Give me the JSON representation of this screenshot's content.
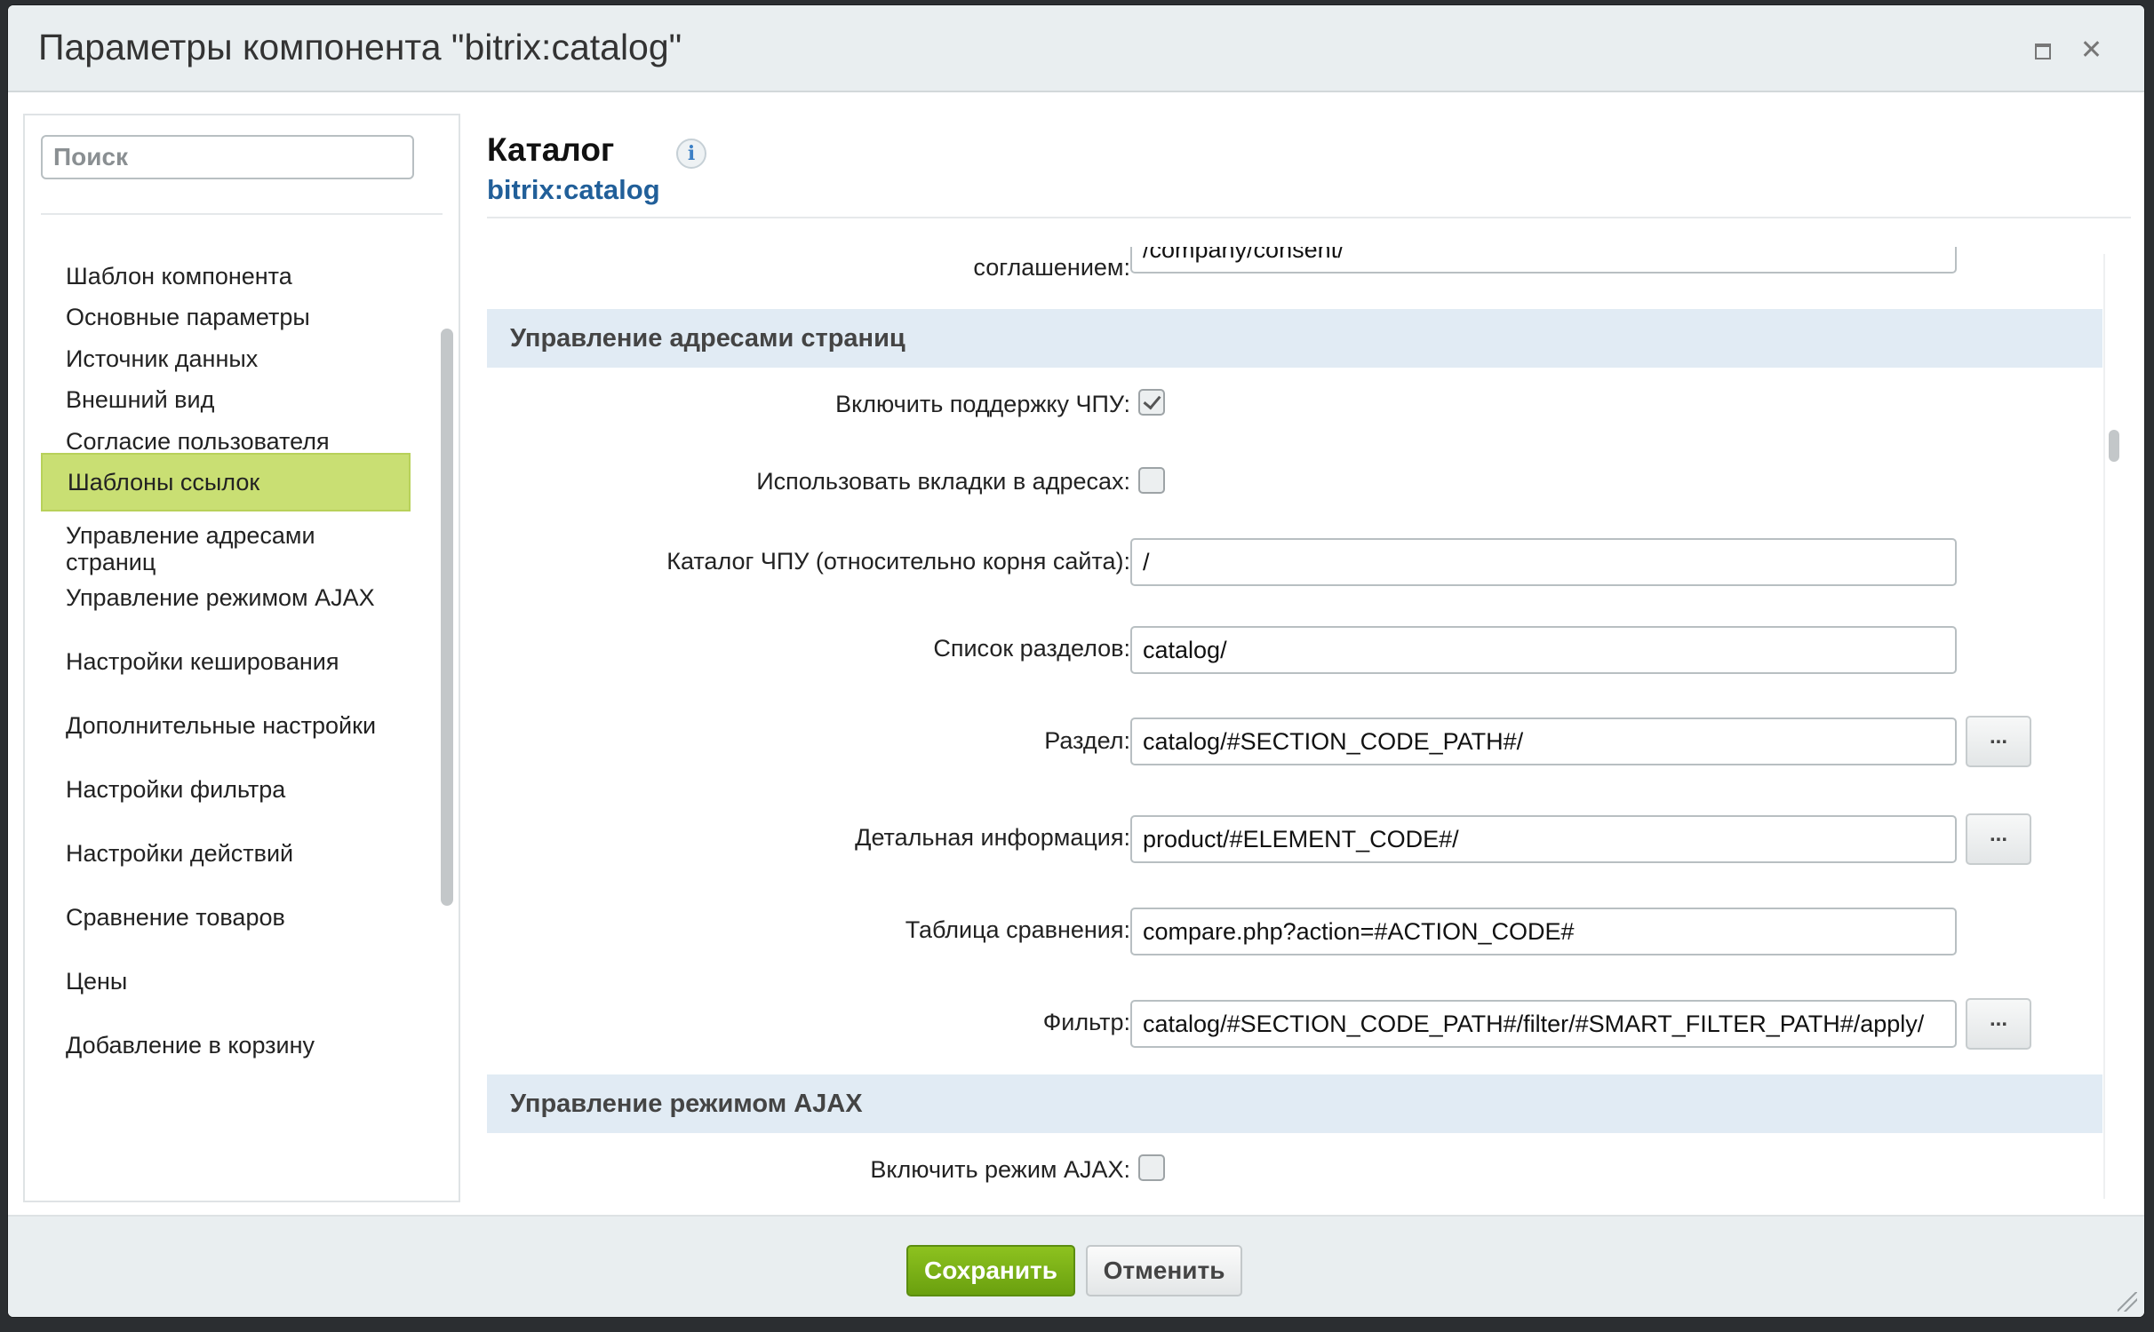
{
  "dialog": {
    "title": "Параметры компонента \"bitrix:catalog\""
  },
  "sidebar": {
    "search_placeholder": "Поиск",
    "items": [
      {
        "label": "Шаблон компонента"
      },
      {
        "label": "Основные параметры"
      },
      {
        "label": "Источник данных"
      },
      {
        "label": "Внешний вид"
      },
      {
        "label": "Согласие пользователя"
      },
      {
        "label": "Шаблоны ссылок",
        "active": true
      },
      {
        "label": "Управление адресами страниц"
      },
      {
        "label": "Управление режимом AJAX"
      },
      {
        "label": "Настройки кеширования"
      },
      {
        "label": "Дополнительные настройки"
      },
      {
        "label": "Настройки фильтра"
      },
      {
        "label": "Настройки действий"
      },
      {
        "label": "Сравнение товаров"
      },
      {
        "label": "Цены"
      },
      {
        "label": "Добавление в корзину"
      }
    ]
  },
  "component": {
    "title": "Каталог",
    "code": "bitrix:catalog"
  },
  "main": {
    "partial_row": {
      "label": "соглашением:",
      "value": "/company/consent/"
    },
    "section_urls": {
      "title": "Управление адресами страниц",
      "sef_enable": {
        "label": "Включить поддержку ЧПУ:",
        "checked": true
      },
      "sef_tabs": {
        "label": "Использовать вкладки в адресах:",
        "checked": false
      },
      "sef_folder": {
        "label": "Каталог ЧПУ (относительно корня сайта):",
        "value": "/"
      },
      "sections_list": {
        "label": "Список разделов:",
        "value": "catalog/"
      },
      "section": {
        "label": "Раздел:",
        "value": "catalog/#SECTION_CODE_PATH#/",
        "button": "..."
      },
      "detail": {
        "label": "Детальная информация:",
        "value": "product/#ELEMENT_CODE#/",
        "button": "..."
      },
      "compare": {
        "label": "Таблица сравнения:",
        "value": "compare.php?action=#ACTION_CODE#"
      },
      "filter": {
        "label": "Фильтр:",
        "value": "catalog/#SECTION_CODE_PATH#/filter/#SMART_FILTER_PATH#/apply/",
        "button": "..."
      }
    },
    "section_ajax": {
      "title": "Управление режимом AJAX",
      "ajax_mode": {
        "label": "Включить режим AJAX:",
        "checked": false
      }
    }
  },
  "footer": {
    "save_label": "Сохранить",
    "cancel_label": "Отменить"
  },
  "colors": {
    "active_item": "#c9df73",
    "section_header": "#e1ebf4",
    "save_button": "#7bb11a",
    "link_code": "#215f99"
  }
}
